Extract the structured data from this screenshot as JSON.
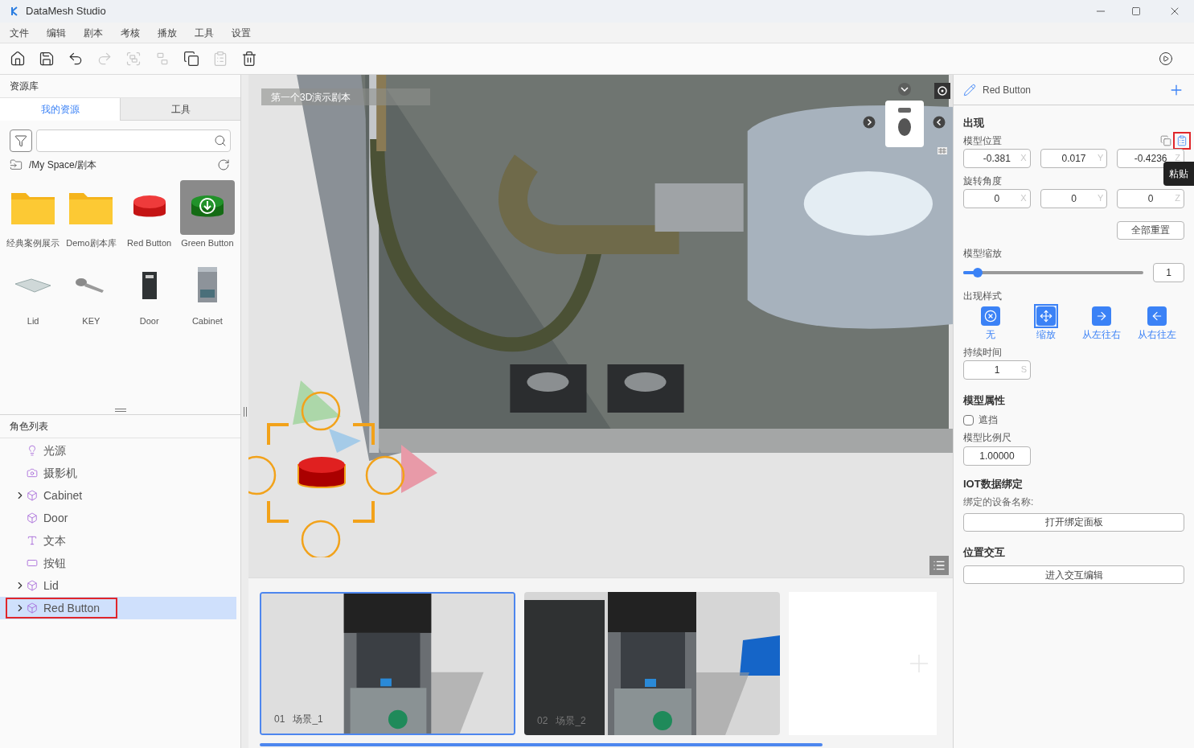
{
  "window": {
    "title": "DataMesh Studio"
  },
  "menu": [
    "文件",
    "编辑",
    "剧本",
    "考核",
    "播放",
    "工具",
    "设置"
  ],
  "toolbar": [
    {
      "kind": "home",
      "disabled": false
    },
    {
      "kind": "save",
      "disabled": false
    },
    {
      "kind": "undo",
      "disabled": false
    },
    {
      "kind": "redo",
      "disabled": true
    },
    {
      "kind": "group",
      "disabled": true
    },
    {
      "kind": "ungroup",
      "disabled": true
    },
    {
      "kind": "copy",
      "disabled": false
    },
    {
      "kind": "paste",
      "disabled": true
    },
    {
      "kind": "delete",
      "disabled": false
    }
  ],
  "resources": {
    "title": "资源库",
    "tabs": [
      {
        "label": "我的资源",
        "selected": true
      },
      {
        "label": "工具",
        "selected": false
      }
    ],
    "path": "/My Space/剧本",
    "items": [
      {
        "label": "经典案例展示",
        "kind": "folder",
        "selected": false
      },
      {
        "label": "Demo剧本库",
        "kind": "folder",
        "selected": false
      },
      {
        "label": "Red Button",
        "kind": "red-button",
        "selected": false
      },
      {
        "label": "Green Button",
        "kind": "green-button",
        "selected": true
      },
      {
        "label": "Lid",
        "kind": "lid",
        "selected": false
      },
      {
        "label": "KEY",
        "kind": "key",
        "selected": false
      },
      {
        "label": "Door",
        "kind": "door",
        "selected": false
      },
      {
        "label": "Cabinet",
        "kind": "cabinet",
        "selected": false
      }
    ]
  },
  "roles": {
    "title": "角色列表",
    "items": [
      {
        "label": "光源",
        "kind": "light",
        "expandable": false,
        "selected": false
      },
      {
        "label": "摄影机",
        "kind": "camera",
        "expandable": false,
        "selected": false
      },
      {
        "label": "Cabinet",
        "kind": "model",
        "expandable": true,
        "selected": false
      },
      {
        "label": "Door",
        "kind": "model",
        "expandable": false,
        "selected": false
      },
      {
        "label": "文本",
        "kind": "text",
        "expandable": false,
        "selected": false
      },
      {
        "label": "按钮",
        "kind": "button",
        "expandable": false,
        "selected": false
      },
      {
        "label": "Lid",
        "kind": "model",
        "expandable": true,
        "selected": false
      },
      {
        "label": "Red Button",
        "kind": "model",
        "expandable": true,
        "selected": true
      }
    ]
  },
  "viewport": {
    "scene_title": "第一个3D演示剧本"
  },
  "scenes": [
    {
      "number": "01",
      "name": "场景_1",
      "selected": true
    },
    {
      "number": "02",
      "name": "场景_2",
      "selected": false
    }
  ],
  "inspector": {
    "title": "Red Button",
    "appear": {
      "heading": "出现",
      "position_label": "模型位置",
      "position": [
        {
          "value": "-0.381",
          "axis": "X"
        },
        {
          "value": "0.017",
          "axis": "Y"
        },
        {
          "value": "-0.4236",
          "axis": "Z"
        }
      ],
      "tooltip": "粘贴",
      "rotation_label": "旋转角度",
      "rotation": [
        {
          "value": "0",
          "axis": "X"
        },
        {
          "value": "0",
          "axis": "Y"
        },
        {
          "value": "0",
          "axis": "Z"
        }
      ],
      "reset": "全部重置",
      "scale_label": "模型缩放",
      "scale": {
        "level": 0.08,
        "value": "1"
      },
      "style_label": "出现样式",
      "styles": [
        {
          "label": "无",
          "kind": "none",
          "selected": false
        },
        {
          "label": "缩放",
          "kind": "scale",
          "selected": true
        },
        {
          "label": "从左往右",
          "kind": "left-to-right",
          "selected": false
        },
        {
          "label": "从右往左",
          "kind": "right-to-left",
          "selected": false
        }
      ],
      "duration_label": "持续时间",
      "duration": {
        "value": "1",
        "unit": "S"
      }
    },
    "model": {
      "heading": "模型属性",
      "occlude": {
        "label": "遮挡",
        "checked": false
      },
      "ratio_label": "模型比例尺",
      "ratio": "1.00000"
    },
    "iot": {
      "heading": "IOT数据绑定",
      "device_label": "绑定的设备名称:",
      "button": "打开绑定面板"
    },
    "interaction": {
      "heading": "位置交互",
      "button": "进入交互编辑"
    }
  }
}
